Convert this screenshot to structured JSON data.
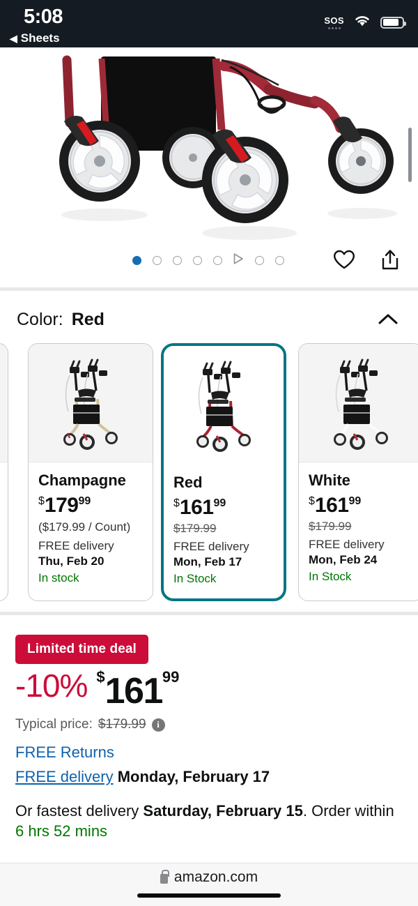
{
  "status_bar": {
    "time": "5:08",
    "back_label": "Sheets",
    "back_arrow": "◀",
    "sos_label": "SOS"
  },
  "hero": {
    "alt": "product-photo-rollator-walker-wheels",
    "indicators": [
      "dot-active",
      "dot",
      "dot",
      "dot",
      "dot",
      "play",
      "dot",
      "dot"
    ],
    "favorite_icon": "heart-icon",
    "share_icon": "share-icon"
  },
  "color_section": {
    "label": "Color:",
    "value": "Red",
    "collapse_icon": "chevron-up-icon"
  },
  "variants": [
    {
      "name": "Champagne",
      "price_symbol": "$",
      "price_whole": "179",
      "price_frac": "99",
      "unit_price": "($179.99 / Count)",
      "strike_price": "",
      "delivery_label": "FREE delivery",
      "delivery_date": "Thu, Feb 20",
      "stock": "In stock",
      "selected": false
    },
    {
      "name": "Red",
      "price_symbol": "$",
      "price_whole": "161",
      "price_frac": "99",
      "unit_price": "",
      "strike_price": "$179.99",
      "delivery_label": "FREE delivery",
      "delivery_date": "Mon, Feb 17",
      "stock": "In Stock",
      "selected": true
    },
    {
      "name": "White",
      "price_symbol": "$",
      "price_whole": "161",
      "price_frac": "99",
      "unit_price": "",
      "strike_price": "$179.99",
      "delivery_label": "FREE delivery",
      "delivery_date": "Mon, Feb 24",
      "stock": "In Stock",
      "selected": false
    }
  ],
  "deal": {
    "badge": "Limited time deal",
    "discount": "-10%",
    "price_symbol": "$",
    "price_whole": "161",
    "price_frac": "99",
    "typical_label": "Typical price:",
    "typical_price": "$179.99",
    "info_icon_glyph": "i",
    "free_returns": "FREE Returns",
    "free_delivery_link": "FREE delivery",
    "free_delivery_date": "Monday, February 17",
    "fastest_prefix": "Or fastest delivery ",
    "fastest_date": "Saturday, February 15",
    "fastest_mid": ". Order within ",
    "fastest_countdown": "6 hrs 52 mins"
  },
  "bottom_bar": {
    "lock_icon": "lock-icon",
    "url": "amazon.com"
  },
  "colors": {
    "accent_blue": "#146eb4",
    "deal_red": "#cc0c39",
    "in_stock_green": "#007600",
    "selected_border": "#057585",
    "link_blue": "#0f62ad"
  }
}
